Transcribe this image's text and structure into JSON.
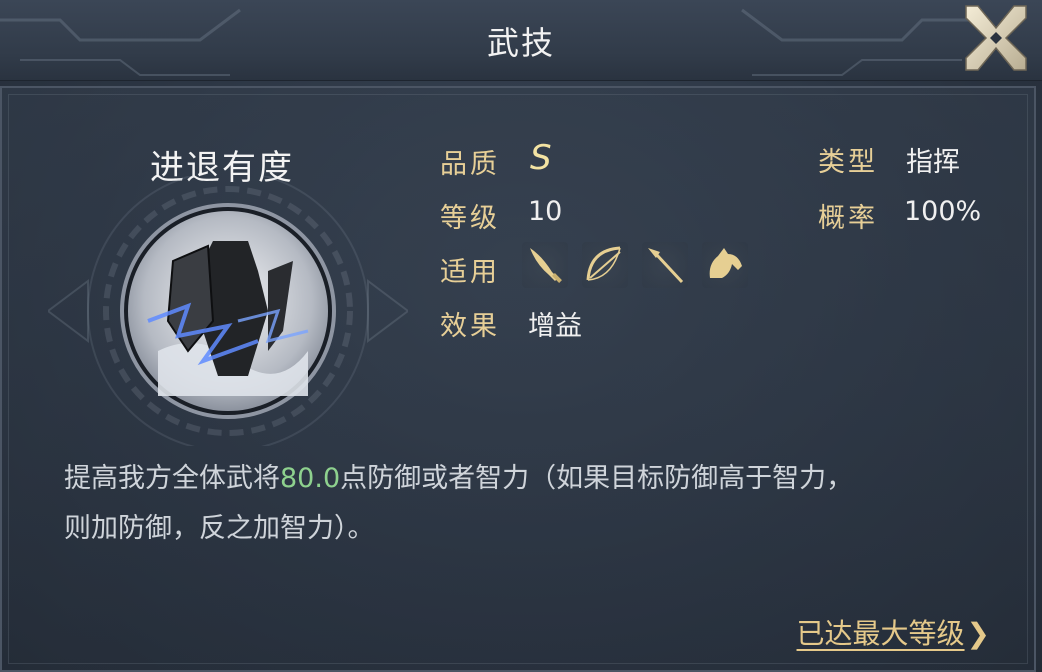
{
  "header": {
    "title": "武技"
  },
  "skill": {
    "name": "进退有度",
    "attributes": {
      "quality_label": "品质",
      "quality_value": "S",
      "level_label": "等级",
      "level_value": "10",
      "applicable_label": "适用",
      "effect_label": "效果",
      "effect_value": "增益",
      "type_label": "类型",
      "type_value": "指挥",
      "chance_label": "概率",
      "chance_value": "100%"
    },
    "applicable_units": [
      "sword-icon",
      "bow-icon",
      "spear-icon",
      "horse-icon"
    ]
  },
  "description": {
    "before": "提高我方全体武将",
    "number": "80.0",
    "after": "点防御或者智力（如果目标防御高于智力，",
    "line2": "则加防御，反之加智力）。"
  },
  "footer": {
    "max_level_label": "已达最大等级",
    "chevron": "❯"
  },
  "colors": {
    "accent_gold": "#e7cf97",
    "highlight_green": "#8ed18e"
  }
}
